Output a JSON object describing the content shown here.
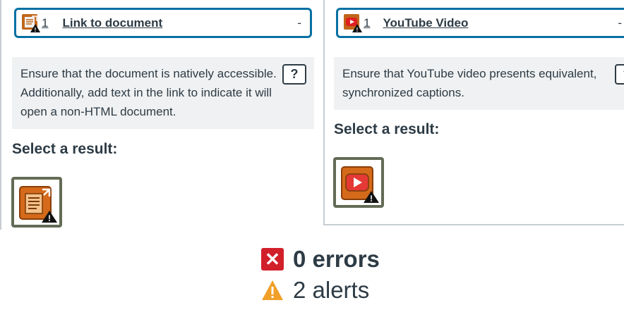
{
  "items": [
    {
      "count": "1",
      "title": "Link to document",
      "dash": "-",
      "icon": "document-link-alert-icon",
      "advice": "Ensure that the document is natively accessible. Additionally, add text in the link to indicate it will open a non-HTML document.",
      "help": "?",
      "select_label": "Select a result:"
    },
    {
      "count": "1",
      "title": "YouTube Video",
      "dash": "-",
      "icon": "youtube-video-alert-icon",
      "advice": "Ensure that YouTube video presents equivalent, synchronized captions.",
      "help": "?",
      "select_label": "Select a result:"
    }
  ],
  "summary": {
    "errors": "0 errors",
    "alerts": "2 alerts",
    "error_icon": "✕"
  },
  "colors": {
    "accent_border": "#0770a3",
    "error_red": "#d1202a",
    "alert_orange": "#f0a029",
    "icon_orange": "#d46a1a"
  }
}
